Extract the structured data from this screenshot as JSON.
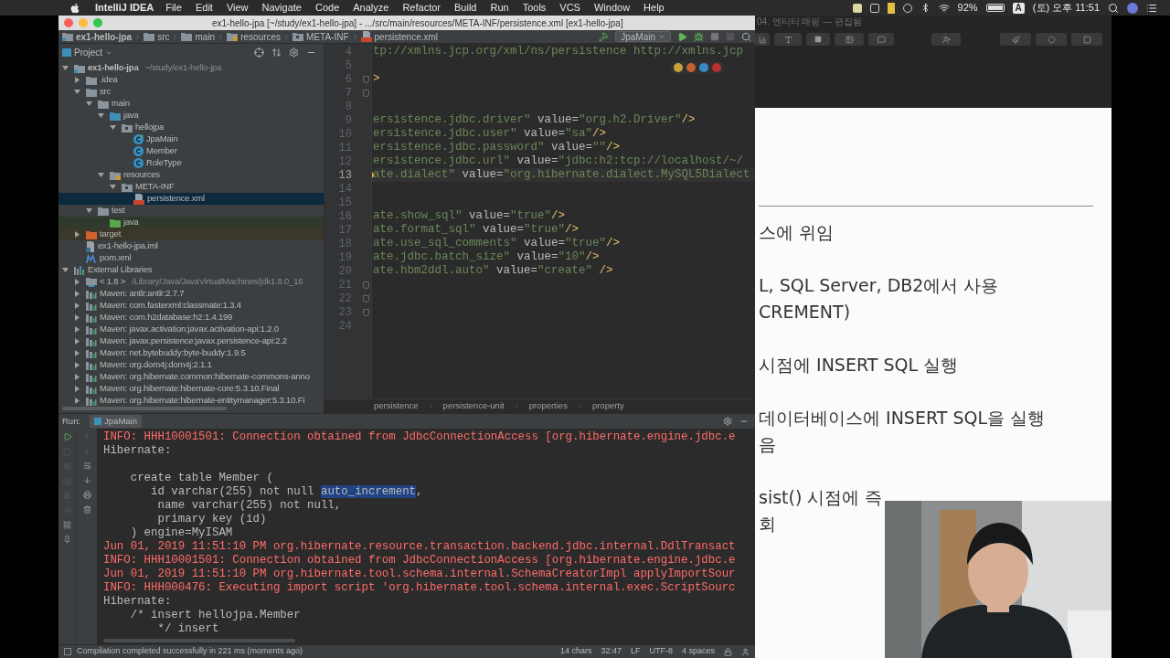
{
  "menubar": {
    "app": "IntelliJ IDEA",
    "menus": [
      "File",
      "Edit",
      "View",
      "Navigate",
      "Code",
      "Analyze",
      "Refactor",
      "Build",
      "Run",
      "Tools",
      "VCS",
      "Window",
      "Help"
    ],
    "battery": "92%",
    "input_source": "A",
    "clock": "(토) 오후 11:51"
  },
  "ide": {
    "title": "ex1-hello-jpa [~/study/ex1-hello-jpa] - .../src/main/resources/META-INF/persistence.xml [ex1-hello-jpa]",
    "breadcrumb": [
      {
        "label": "ex1-hello-jpa",
        "kind": "module"
      },
      {
        "label": "src",
        "kind": "folder"
      },
      {
        "label": "main",
        "kind": "folder"
      },
      {
        "label": "resources",
        "kind": "resources"
      },
      {
        "label": "META-INF",
        "kind": "package"
      },
      {
        "label": "persistence.xml",
        "kind": "xml"
      }
    ],
    "run_config": "JpaMain",
    "project": {
      "title": "Project",
      "tree": [
        {
          "label": "ex1-hello-jpa",
          "hint": "~/study/ex1-hello-jpa",
          "kind": "module",
          "expanded": true,
          "selected": false,
          "children": [
            {
              "label": ".idea",
              "kind": "folder",
              "expanded": false,
              "selected": false
            },
            {
              "label": "src",
              "kind": "folder",
              "expanded": true,
              "selected": false,
              "children": [
                {
                  "label": "main",
                  "kind": "folder",
                  "expanded": true,
                  "selected": false,
                  "children": [
                    {
                      "label": "java",
                      "kind": "source",
                      "expanded": true,
                      "selected": false,
                      "children": [
                        {
                          "label": "hellojpa",
                          "kind": "package",
                          "expanded": true,
                          "selected": false,
                          "children": [
                            {
                              "label": "JpaMain",
                              "kind": "main-class",
                              "selected": false
                            },
                            {
                              "label": "Member",
                              "kind": "class",
                              "selected": false
                            },
                            {
                              "label": "RoleType",
                              "kind": "class",
                              "selected": false
                            }
                          ]
                        }
                      ]
                    },
                    {
                      "label": "resources",
                      "kind": "resources",
                      "expanded": true,
                      "selected": false,
                      "children": [
                        {
                          "label": "META-INF",
                          "kind": "package",
                          "expanded": true,
                          "selected": false,
                          "children": [
                            {
                              "label": "persistence.xml",
                              "kind": "xml",
                              "selected": true
                            }
                          ]
                        }
                      ]
                    }
                  ]
                },
                {
                  "label": "test",
                  "kind": "folder",
                  "expanded": true,
                  "selected": false,
                  "children": [
                    {
                      "label": "java",
                      "kind": "test-root",
                      "selected": false
                    }
                  ]
                }
              ]
            },
            {
              "label": "target",
              "kind": "excluded",
              "expanded": false,
              "selected": false
            },
            {
              "label": "ex1-hello-jpa.iml",
              "kind": "iml",
              "selected": false
            },
            {
              "label": "pom.xml",
              "kind": "maven",
              "selected": false
            }
          ]
        },
        {
          "label": "External Libraries",
          "kind": "libraries",
          "expanded": true,
          "selected": false,
          "children": [
            {
              "label": "< 1.8 >",
              "hint": "/Library/Java/JavaVirtualMachines/jdk1.8.0_16",
              "kind": "jdk",
              "expanded": false,
              "selected": false
            },
            {
              "label": "Maven: antlr:antlr:2.7.7",
              "kind": "library",
              "expanded": false,
              "selected": false
            },
            {
              "label": "Maven: com.fasterxml:classmate:1.3.4",
              "kind": "library",
              "expanded": false,
              "selected": false
            },
            {
              "label": "Maven: com.h2database:h2:1.4.199",
              "kind": "library",
              "expanded": false,
              "selected": false
            },
            {
              "label": "Maven: javax.activation:javax.activation-api:1.2.0",
              "kind": "library",
              "expanded": false,
              "selected": false
            },
            {
              "label": "Maven: javax.persistence:javax.persistence-api:2.2",
              "kind": "library",
              "expanded": false,
              "selected": false
            },
            {
              "label": "Maven: net.bytebuddy:byte-buddy:1.9.5",
              "kind": "library",
              "expanded": false,
              "selected": false
            },
            {
              "label": "Maven: org.dom4j:dom4j:2.1.1",
              "kind": "library",
              "expanded": false,
              "selected": false
            },
            {
              "label": "Maven: org.hibernate.common:hibernate-commons-anno",
              "kind": "library",
              "expanded": false,
              "selected": false
            },
            {
              "label": "Maven: org.hibernate:hibernate-core:5.3.10.Final",
              "kind": "library",
              "expanded": false,
              "selected": false
            },
            {
              "label": "Maven: org.hibernate:hibernate-entitymanager:5.3.10.Fi",
              "kind": "library",
              "expanded": false,
              "selected": false
            }
          ]
        }
      ]
    },
    "editor": {
      "lines": [
        {
          "number": "4",
          "current": false,
          "tokens": [
            {
              "kind": "string",
              "text": "tp://xmlns.jcp.org/xml/ns/persistence http://xmlns.jcp"
            }
          ]
        },
        {
          "number": "5",
          "current": false
        },
        {
          "number": "6",
          "current": false,
          "fold": true,
          "tokens": [
            {
              "kind": "tag",
              "text": ">"
            }
          ]
        },
        {
          "number": "7",
          "current": false,
          "fold": true
        },
        {
          "number": "8",
          "current": false
        },
        {
          "number": "9",
          "current": false,
          "tokens": [
            {
              "kind": "string",
              "text": "ersistence.jdbc.driver\""
            },
            {
              "kind": "attr",
              "text": " value="
            },
            {
              "kind": "string",
              "text": "\"org.h2.Driver\""
            },
            {
              "kind": "tag",
              "text": "/>"
            }
          ]
        },
        {
          "number": "10",
          "current": false,
          "tokens": [
            {
              "kind": "string",
              "text": "ersistence.jdbc.user\""
            },
            {
              "kind": "attr",
              "text": " value="
            },
            {
              "kind": "string",
              "text": "\"sa\""
            },
            {
              "kind": "tag",
              "text": "/>"
            }
          ]
        },
        {
          "number": "11",
          "current": false,
          "tokens": [
            {
              "kind": "string",
              "text": "ersistence.jdbc.password\""
            },
            {
              "kind": "attr",
              "text": " value="
            },
            {
              "kind": "string",
              "text": "\"\""
            },
            {
              "kind": "tag",
              "text": "/>"
            }
          ]
        },
        {
          "number": "12",
          "current": false,
          "tokens": [
            {
              "kind": "string",
              "text": "ersistence.jdbc.url\""
            },
            {
              "kind": "attr",
              "text": " value="
            },
            {
              "kind": "string",
              "text": "\"jdbc:h2:tcp://localhost/~/"
            }
          ]
        },
        {
          "number": "13",
          "current": true,
          "bulb": true,
          "tokens": [
            {
              "kind": "string",
              "text": "ate.dialect\""
            },
            {
              "kind": "attr",
              "text": " value="
            },
            {
              "kind": "string",
              "text": "\"org.hibernate.dialect.MySQL5Dialect"
            }
          ]
        },
        {
          "number": "14",
          "current": false
        },
        {
          "number": "15",
          "current": false
        },
        {
          "number": "16",
          "current": false,
          "tokens": [
            {
              "kind": "string",
              "text": "ate.show_sql\""
            },
            {
              "kind": "attr",
              "text": " value="
            },
            {
              "kind": "string",
              "text": "\"true\""
            },
            {
              "kind": "tag",
              "text": "/>"
            }
          ]
        },
        {
          "number": "17",
          "current": false,
          "tokens": [
            {
              "kind": "string",
              "text": "ate.format_sql\""
            },
            {
              "kind": "attr",
              "text": " value="
            },
            {
              "kind": "string",
              "text": "\"true\""
            },
            {
              "kind": "tag",
              "text": "/>"
            }
          ]
        },
        {
          "number": "18",
          "current": false,
          "tokens": [
            {
              "kind": "string",
              "text": "ate.use_sql_comments\""
            },
            {
              "kind": "attr",
              "text": " value="
            },
            {
              "kind": "string",
              "text": "\"true\""
            },
            {
              "kind": "tag",
              "text": "/>"
            }
          ]
        },
        {
          "number": "19",
          "current": false,
          "tokens": [
            {
              "kind": "string",
              "text": "ate.jdbc.batch_size\""
            },
            {
              "kind": "attr",
              "text": " value="
            },
            {
              "kind": "string",
              "text": "\"10\""
            },
            {
              "kind": "tag",
              "text": "/>"
            }
          ]
        },
        {
          "number": "20",
          "current": false,
          "tokens": [
            {
              "kind": "string",
              "text": "ate.hbm2ddl.auto\""
            },
            {
              "kind": "attr",
              "text": " value="
            },
            {
              "kind": "string",
              "text": "\"create\""
            },
            {
              "kind": "tag",
              "text": " />"
            }
          ]
        },
        {
          "number": "21",
          "current": false,
          "fold": true
        },
        {
          "number": "22",
          "current": false,
          "fold": true
        },
        {
          "number": "23",
          "current": false,
          "fold": true
        },
        {
          "number": "24",
          "current": false
        }
      ],
      "path": [
        "persistence",
        "persistence-unit",
        "properties",
        "property"
      ]
    },
    "run": {
      "label": "Run:",
      "tab": "JpaMain",
      "lines": [
        {
          "kind": "error",
          "text": "INFO: HHH10001501: Connection obtained from JdbcConnectionAccess [org.hibernate.engine.jdbc.e"
        },
        {
          "kind": "output",
          "text": "Hibernate:"
        },
        {
          "kind": "blank"
        },
        {
          "kind": "output",
          "text": "    create table Member ("
        },
        {
          "kind": "output",
          "parts": [
            {
              "text": "       id varchar(255) not null ",
              "selected": false
            },
            {
              "text": "auto_increment",
              "selected": true
            },
            {
              "text": ",",
              "selected": false
            }
          ]
        },
        {
          "kind": "output",
          "text": "        name varchar(255) not null,"
        },
        {
          "kind": "output",
          "text": "        primary key (id)"
        },
        {
          "kind": "output",
          "text": "    ) engine=MyISAM"
        },
        {
          "kind": "error",
          "text": "Jun 01, 2019 11:51:10 PM org.hibernate.resource.transaction.backend.jdbc.internal.DdlTransact"
        },
        {
          "kind": "error",
          "text": "INFO: HHH10001501: Connection obtained from JdbcConnectionAccess [org.hibernate.engine.jdbc.e"
        },
        {
          "kind": "error",
          "text": "Jun 01, 2019 11:51:10 PM org.hibernate.tool.schema.internal.SchemaCreatorImpl applyImportSour"
        },
        {
          "kind": "error",
          "text": "INFO: HHH000476: Executing import script 'org.hibernate.tool.schema.internal.exec.ScriptSourc"
        },
        {
          "kind": "output",
          "text": "Hibernate:"
        },
        {
          "kind": "output",
          "text": "    /* insert hellojpa.Member"
        },
        {
          "kind": "output",
          "text": "        */ insert"
        }
      ]
    },
    "status": {
      "message": "Compilation completed successfully in 221 ms (moments ago)",
      "items": [
        "14 chars",
        "32:47",
        "LF",
        "UTF-8",
        "4 spaces"
      ]
    }
  },
  "keynote": {
    "title": "04. 엔티티 매핑 — 편집됨",
    "slide_paragraphs": [
      [
        "스에 위임"
      ],
      [
        "L, SQL Server, DB2에서 사용",
        "CREMENT)"
      ],
      [
        "시점에 INSERT SQL 실행"
      ],
      [
        "데이터베이스에 INSERT SQL을 실행",
        "음"
      ],
      [
        "sist() 시점에 즉",
        "회"
      ]
    ]
  }
}
